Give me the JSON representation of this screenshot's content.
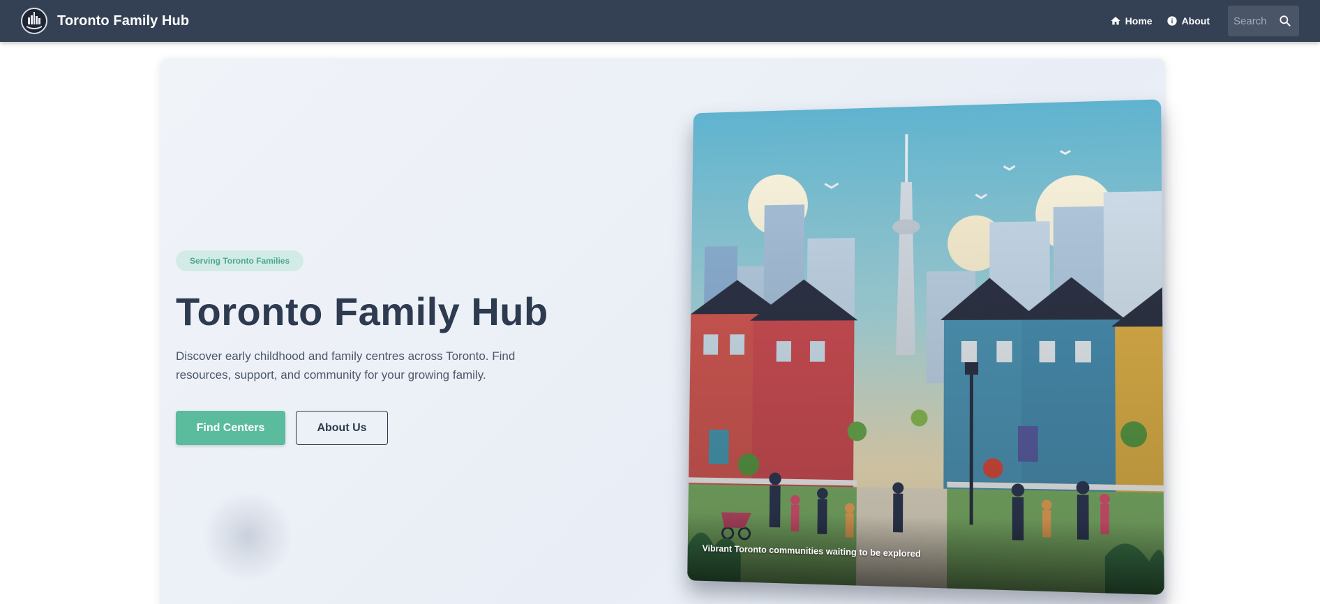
{
  "navbar": {
    "brand_title": "Toronto Family Hub",
    "links": [
      {
        "label": "Home",
        "icon": "home-icon"
      },
      {
        "label": "About",
        "icon": "info-icon"
      }
    ],
    "search_placeholder": "Search",
    "bg_color": "#344054"
  },
  "hero": {
    "badge": "Serving Toronto Families",
    "title": "Toronto Family Hub",
    "description": "Discover early childhood and family centres across Toronto. Find resources, support, and community for your growing family.",
    "primary_button": "Find Centers",
    "secondary_button": "About Us",
    "accent_color": "#5bbb9d",
    "image_caption": "Vibrant Toronto communities waiting to be explored"
  }
}
